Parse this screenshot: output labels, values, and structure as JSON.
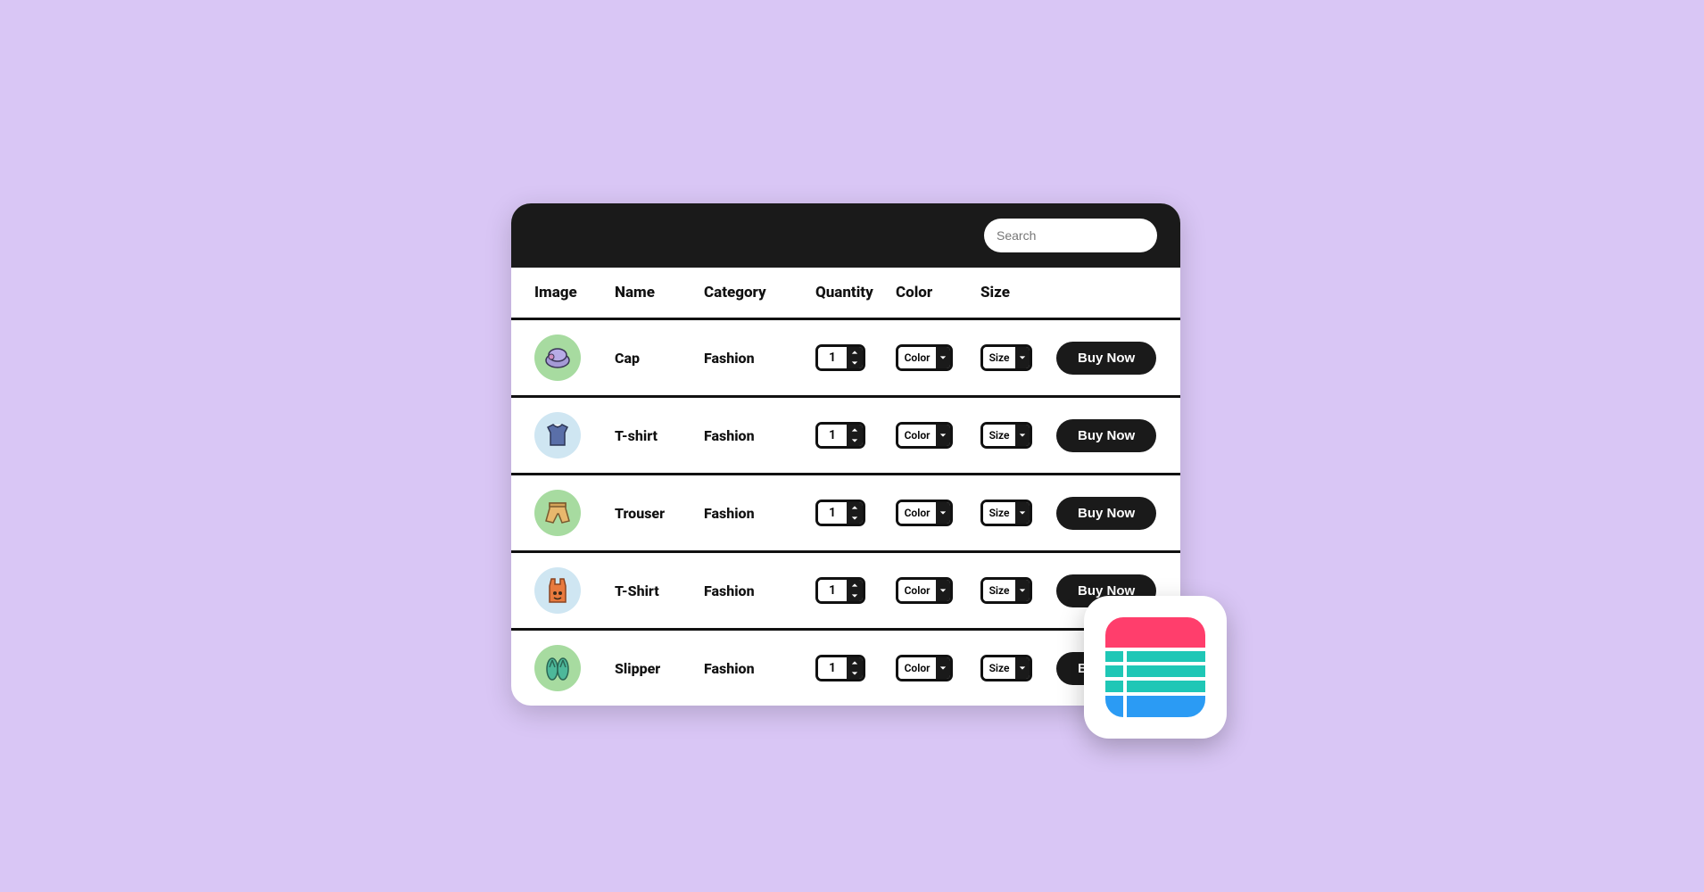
{
  "search": {
    "placeholder": "Search"
  },
  "headers": {
    "image": "Image",
    "name": "Name",
    "category": "Category",
    "quantity": "Quantity",
    "color": "Color",
    "size": "Size"
  },
  "labels": {
    "color_select": "Color",
    "size_select": "Size",
    "buy": "Buy Now"
  },
  "rows": [
    {
      "name": "Cap",
      "category": "Fashion",
      "qty": "1",
      "thumb_bg": "#a7dba0",
      "icon": "cap"
    },
    {
      "name": "T-shirt",
      "category": "Fashion",
      "qty": "1",
      "thumb_bg": "#cfe6f2",
      "icon": "tshirt"
    },
    {
      "name": "Trouser",
      "category": "Fashion",
      "qty": "1",
      "thumb_bg": "#a7dba0",
      "icon": "trouser"
    },
    {
      "name": "T-Shirt",
      "category": "Fashion",
      "qty": "1",
      "thumb_bg": "#cfe6f2",
      "icon": "tank"
    },
    {
      "name": "Slipper",
      "category": "Fashion",
      "qty": "1",
      "thumb_bg": "#a7dba0",
      "icon": "slipper"
    }
  ],
  "colors": {
    "bg": "#d9c6f5",
    "panel_header": "#1a1a1a",
    "badge_pink": "#ff3e6c",
    "badge_teal": "#1fc7b6",
    "badge_blue": "#2b9bf4"
  }
}
